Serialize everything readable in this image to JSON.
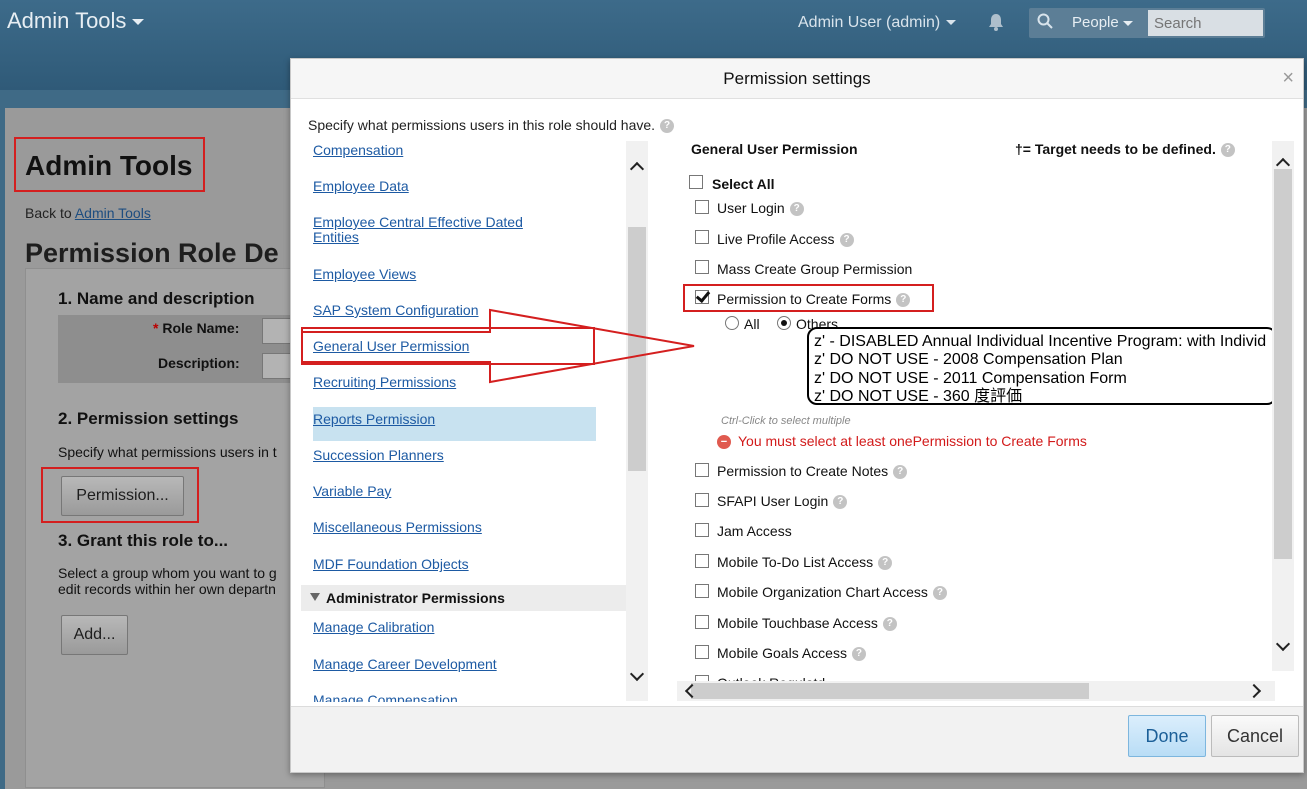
{
  "header": {
    "app_title": "Admin Tools",
    "user_menu": "Admin User (admin)",
    "search_scope": "People",
    "search_placeholder": "Search"
  },
  "background_page": {
    "title": "Admin Tools",
    "back_prefix": "Back to",
    "back_link": "Admin Tools",
    "heading": "Permission Role De",
    "section1": "1. Name and description",
    "role_name_required": "*",
    "role_name_label": "Role Name:",
    "description_label": "Description:",
    "section2": "2. Permission settings",
    "section2_text": "Specify what permissions users in t",
    "permission_button": "Permission...",
    "section3": "3. Grant this role to...",
    "section3_text_line1": "Select a group whom you want to g",
    "section3_text_line2": "edit records within her own departn",
    "add_button": "Add..."
  },
  "modal": {
    "title": "Permission settings",
    "close_glyph": "×",
    "description": "Specify what permissions users in this role should have.",
    "help_glyph": "?",
    "categories": [
      "Compensation",
      "Employee Data",
      "Employee Central Effective Dated",
      "Entities",
      "Employee Views",
      "SAP System Configuration",
      "General User Permission",
      "Recruiting Permissions",
      "Reports Permission",
      "Succession Planners",
      "Variable Pay",
      "Miscellaneous Permissions",
      "MDF Foundation Objects"
    ],
    "category_group": "Administrator Permissions",
    "admin_categories": [
      "Manage Calibration",
      "Manage Career Development",
      "Manage Compensation"
    ],
    "panel_title": "General User Permission",
    "target_note": "†= Target needs to be defined.",
    "select_all": "Select All",
    "permissions": [
      {
        "label": "User Login",
        "checked": false,
        "help": true
      },
      {
        "label": "Live Profile Access",
        "checked": false,
        "help": true
      },
      {
        "label": "Mass Create Group Permission",
        "checked": false,
        "help": false
      },
      {
        "label": "Permission to Create Forms",
        "checked": true,
        "help": true
      }
    ],
    "scope_all": "All",
    "scope_others": "Others",
    "scope_selected": "Others",
    "forms_options": [
      "z' - DISABLED Annual Individual Incentive Program: with Individ",
      "z' DO NOT USE - 2008 Compensation Plan",
      "z' DO NOT USE - 2011 Compensation Form",
      "z' DO NOT USE - 360 度評価"
    ],
    "multi_select_hint": "Ctrl-Click to select multiple",
    "error_icon": "−",
    "error_message": "You must select at least onePermission to Create Forms",
    "more_permissions": [
      {
        "label": "Permission to Create Notes",
        "checked": false,
        "help": true
      },
      {
        "label": "SFAPI User Login",
        "checked": false,
        "help": true
      },
      {
        "label": "Jam Access",
        "checked": false,
        "help": false
      },
      {
        "label": "Mobile To-Do List Access",
        "checked": false,
        "help": true
      },
      {
        "label": "Mobile Organization Chart Access",
        "checked": false,
        "help": true
      },
      {
        "label": "Mobile Touchbase Access",
        "checked": false,
        "help": true
      },
      {
        "label": "Mobile Goals Access",
        "checked": false,
        "help": true
      },
      {
        "label": "Outlook Regulatd",
        "checked": false,
        "help": false
      }
    ],
    "done_button": "Done",
    "cancel_button": "Cancel"
  },
  "colors": {
    "annotation_red": "#d41f1f",
    "link_blue": "#1d5aa3",
    "error_red": "#d21a1a",
    "selected_bg": "#c8e2f0",
    "header_bg": "#3d6b8a"
  }
}
